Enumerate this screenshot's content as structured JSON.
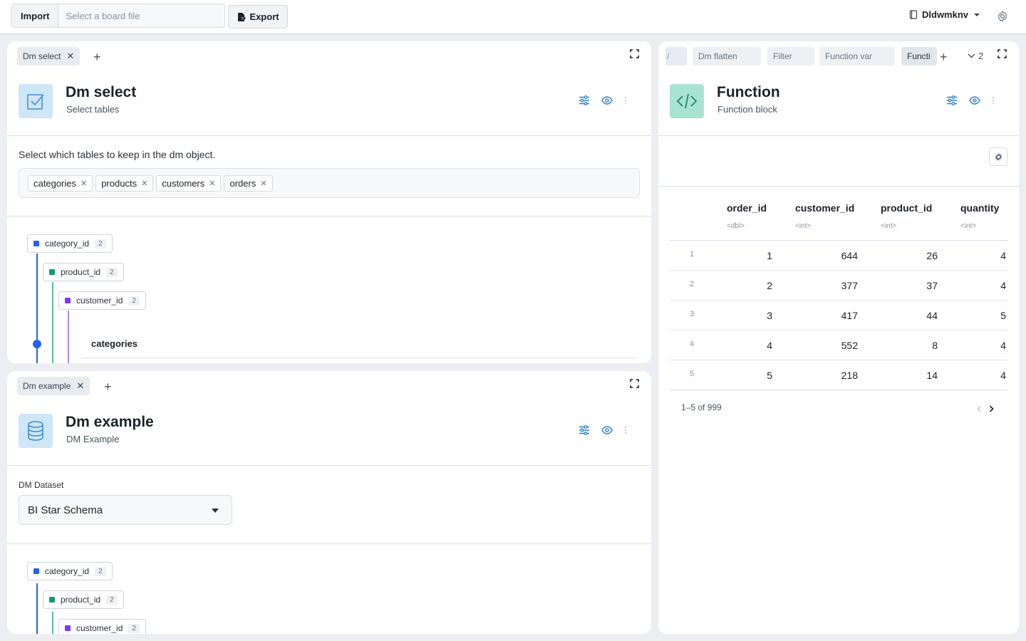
{
  "topbar": {
    "import_label": "Import",
    "import_placeholder": "Select a board file",
    "export_label": "Export",
    "user_name": "Dldwmknv"
  },
  "panel_select": {
    "tab_label": "Dm select",
    "title": "Dm select",
    "subtitle": "Select tables",
    "instruction": "Select which tables to keep in the dm object.",
    "chips": [
      "categories",
      "products",
      "customers",
      "orders"
    ],
    "tree": [
      {
        "label": "category_id",
        "count": "2",
        "color": "#2563eb"
      },
      {
        "label": "product_id",
        "count": "2",
        "color": "#0f9a7e"
      },
      {
        "label": "customer_id",
        "count": "2",
        "color": "#7c3aed"
      }
    ],
    "table_label": "categories"
  },
  "panel_example": {
    "tab_label": "Dm example",
    "title": "Dm example",
    "subtitle": "DM Example",
    "field_label": "DM Dataset",
    "dataset_value": "BI Star Schema",
    "tree": [
      {
        "label": "category_id",
        "count": "2",
        "color": "#2563eb"
      },
      {
        "label": "product_id",
        "count": "2",
        "color": "#0f9a7e"
      },
      {
        "label": "customer_id",
        "count": "2",
        "color": "#7c3aed"
      }
    ]
  },
  "panel_function": {
    "tabs": [
      "Dm flatten",
      "Filter",
      "Function var",
      "Functi"
    ],
    "more_count": "2",
    "title": "Function",
    "subtitle": "Function block",
    "columns": [
      {
        "name": "order_id",
        "type": "<dbl>"
      },
      {
        "name": "customer_id",
        "type": "<int>"
      },
      {
        "name": "product_id",
        "type": "<int>"
      },
      {
        "name": "quantity",
        "type": "<int>"
      }
    ],
    "rows": [
      {
        "n": "1",
        "order_id": "1",
        "customer_id": "644",
        "product_id": "26",
        "quantity": "4"
      },
      {
        "n": "2",
        "order_id": "2",
        "customer_id": "377",
        "product_id": "37",
        "quantity": "4"
      },
      {
        "n": "3",
        "order_id": "3",
        "customer_id": "417",
        "product_id": "44",
        "quantity": "5"
      },
      {
        "n": "4",
        "order_id": "4",
        "customer_id": "552",
        "product_id": "8",
        "quantity": "4"
      },
      {
        "n": "5",
        "order_id": "5",
        "customer_id": "218",
        "product_id": "14",
        "quantity": "4"
      }
    ],
    "pagination": "1–5 of 999"
  },
  "colors": {
    "accent": "#2563eb",
    "select_icon_bg": "#cfe6f7",
    "function_icon_bg": "#a9e3d2"
  }
}
